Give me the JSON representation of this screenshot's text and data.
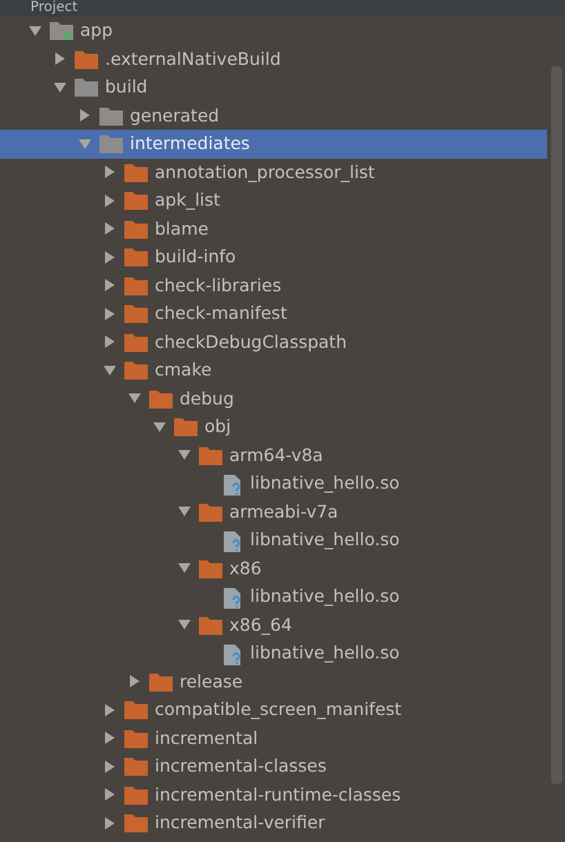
{
  "panel": {
    "title": "Project"
  },
  "tree": [
    {
      "label": "app",
      "kind": "module",
      "expanded": true,
      "selected": false,
      "children": [
        {
          "label": ".externalNativeBuild",
          "kind": "folder",
          "expanded": false,
          "selected": false
        },
        {
          "label": "build",
          "kind": "excluded",
          "expanded": true,
          "selected": false,
          "children": [
            {
              "label": "generated",
              "kind": "excluded",
              "expanded": false,
              "selected": false
            },
            {
              "label": "intermediates",
              "kind": "excluded",
              "expanded": true,
              "selected": true,
              "children": [
                {
                  "label": "annotation_processor_list",
                  "kind": "folder",
                  "expanded": false,
                  "selected": false
                },
                {
                  "label": "apk_list",
                  "kind": "folder",
                  "expanded": false,
                  "selected": false
                },
                {
                  "label": "blame",
                  "kind": "folder",
                  "expanded": false,
                  "selected": false
                },
                {
                  "label": "build-info",
                  "kind": "folder",
                  "expanded": false,
                  "selected": false
                },
                {
                  "label": "check-libraries",
                  "kind": "folder",
                  "expanded": false,
                  "selected": false
                },
                {
                  "label": "check-manifest",
                  "kind": "folder",
                  "expanded": false,
                  "selected": false
                },
                {
                  "label": "checkDebugClasspath",
                  "kind": "folder",
                  "expanded": false,
                  "selected": false
                },
                {
                  "label": "cmake",
                  "kind": "folder",
                  "expanded": true,
                  "selected": false,
                  "children": [
                    {
                      "label": "debug",
                      "kind": "folder",
                      "expanded": true,
                      "selected": false,
                      "children": [
                        {
                          "label": "obj",
                          "kind": "folder",
                          "expanded": true,
                          "selected": false,
                          "children": [
                            {
                              "label": "arm64-v8a",
                              "kind": "folder",
                              "expanded": true,
                              "selected": false,
                              "children": [
                                {
                                  "label": "libnative_hello.so",
                                  "kind": "file",
                                  "selected": false
                                }
                              ]
                            },
                            {
                              "label": "armeabi-v7a",
                              "kind": "folder",
                              "expanded": true,
                              "selected": false,
                              "children": [
                                {
                                  "label": "libnative_hello.so",
                                  "kind": "file",
                                  "selected": false
                                }
                              ]
                            },
                            {
                              "label": "x86",
                              "kind": "folder",
                              "expanded": true,
                              "selected": false,
                              "children": [
                                {
                                  "label": "libnative_hello.so",
                                  "kind": "file",
                                  "selected": false
                                }
                              ]
                            },
                            {
                              "label": "x86_64",
                              "kind": "folder",
                              "expanded": true,
                              "selected": false,
                              "children": [
                                {
                                  "label": "libnative_hello.so",
                                  "kind": "file",
                                  "selected": false
                                }
                              ]
                            }
                          ]
                        }
                      ]
                    },
                    {
                      "label": "release",
                      "kind": "folder",
                      "expanded": false,
                      "selected": false
                    }
                  ]
                },
                {
                  "label": "compatible_screen_manifest",
                  "kind": "folder",
                  "expanded": false,
                  "selected": false
                },
                {
                  "label": "incremental",
                  "kind": "folder",
                  "expanded": false,
                  "selected": false
                },
                {
                  "label": "incremental-classes",
                  "kind": "folder",
                  "expanded": false,
                  "selected": false
                },
                {
                  "label": "incremental-runtime-classes",
                  "kind": "folder",
                  "expanded": false,
                  "selected": false
                },
                {
                  "label": "incremental-verifier",
                  "kind": "folder",
                  "expanded": false,
                  "selected": false
                }
              ]
            }
          ]
        }
      ]
    }
  ]
}
